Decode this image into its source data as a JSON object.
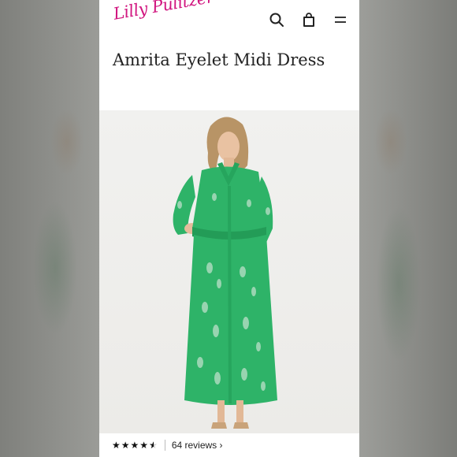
{
  "brand": {
    "logo_text": "Lilly Pulitzer",
    "logo_color": "#d1157f"
  },
  "header": {
    "icons": [
      "search-icon",
      "shopping-bag-icon",
      "menu-icon"
    ]
  },
  "product": {
    "title": "Amrita Eyelet Midi Dress",
    "dress_color": "#2eb368",
    "rating": 4.5,
    "rating_max": 5,
    "reviews_label": "64 reviews ›"
  }
}
